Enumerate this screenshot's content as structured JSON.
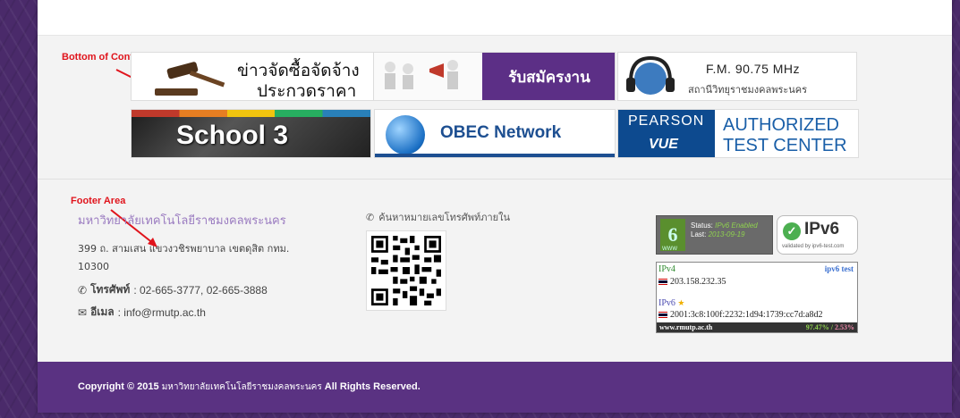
{
  "annotations": {
    "content": "Bottom of Content",
    "footer": "Footer Area"
  },
  "banners": {
    "procurement": {
      "line1": "ข่าวจัดซื้อจัดจ้าง",
      "line2": "ประกวดราคา"
    },
    "recruitment": {
      "label": "รับสมัครงาน"
    },
    "radio": {
      "freq": "F.M. 90.75 MHz",
      "station": "สถานีวิทยุราชมงคลพระนคร"
    },
    "school": {
      "label": "School 3"
    },
    "obec": {
      "label": "OBEC Network"
    },
    "pearson": {
      "brand": "PEARSON",
      "vue": "VUE",
      "auth1": "AUTHORIZED",
      "auth2": "TEST CENTER"
    }
  },
  "footer": {
    "university": "มหาวิทยาลัยเทคโนโลยีราชมงคลพระนคร",
    "address_line1": "399 ถ. สามเสน แขวงวชิรพยาบาล เขตดุสิต กทม.",
    "address_line2": "10300",
    "phone_label": "โทรศัพท์",
    "phone_value": ": 02-665-3777, 02-665-3888",
    "email_label": "อีเมล",
    "email_value": ": info@rmutp.ac.th",
    "phone_search": "ค้นหาหมายเลขโทรศัพท์ภายใน"
  },
  "ipv6": {
    "badge_number": "6",
    "status_label": "Status:",
    "status_value": "IPv6 Enabled",
    "last_label": "Last:",
    "last_value": "2013-09-19",
    "badge_footer": "WWW",
    "validated_title": "IPv6",
    "validated_sub": "validated by ipv6-test.com",
    "ipv4_label": "IPv4",
    "ipv6_test": "ipv6 test",
    "ipv4_addr": "203.158.232.35",
    "ipv6_label": "IPv6",
    "ipv6_addr": "2001:3c8:100f:2232:1d94:1739:cc7d:a8d2",
    "site": "www.rmutp.ac.th",
    "pct_v4": "97.47%",
    "pct_v6": "2.53%"
  },
  "copyright": {
    "prefix": "Copyright © 2015",
    "org": "มหาวิทยาลัยเทคโนโลยีราชมงคลพระนคร",
    "suffix": "All Rights Reserved."
  },
  "colors": {
    "brand_purple": "#5a3282",
    "annotation_red": "#e0141c"
  }
}
